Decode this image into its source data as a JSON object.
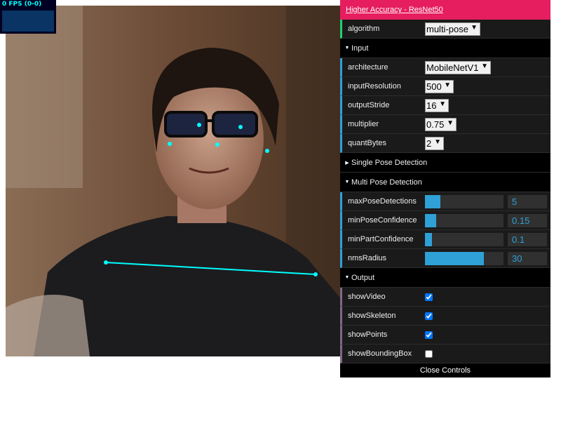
{
  "stats": {
    "fps_text": "0 FPS (0-0)"
  },
  "gui": {
    "title": "Higher Accuracy - ResNet50",
    "algorithm": {
      "label": "algorithm",
      "value": "multi-pose"
    },
    "input_folder": {
      "label": "Input"
    },
    "architecture": {
      "label": "architecture",
      "value": "MobileNetV1"
    },
    "inputResolution": {
      "label": "inputResolution",
      "value": "500"
    },
    "outputStride": {
      "label": "outputStride",
      "value": "16"
    },
    "multiplier": {
      "label": "multiplier",
      "value": "0.75"
    },
    "quantBytes": {
      "label": "quantBytes",
      "value": "2"
    },
    "single_folder": {
      "label": "Single Pose Detection"
    },
    "multi_folder": {
      "label": "Multi Pose Detection"
    },
    "maxPoseDetections": {
      "label": "maxPoseDetections",
      "value": "5",
      "fraction": 0.2
    },
    "minPoseConfidence": {
      "label": "minPoseConfidence",
      "value": "0.15",
      "fraction": 0.14
    },
    "minPartConfidence": {
      "label": "minPartConfidence",
      "value": "0.1",
      "fraction": 0.09
    },
    "nmsRadius": {
      "label": "nmsRadius",
      "value": "30",
      "fraction": 0.75
    },
    "output_folder": {
      "label": "Output"
    },
    "showVideo": {
      "label": "showVideo",
      "checked": true
    },
    "showSkeleton": {
      "label": "showSkeleton",
      "checked": true
    },
    "showPoints": {
      "label": "showPoints",
      "checked": true
    },
    "showBoundingBox": {
      "label": "showBoundingBox",
      "checked": false
    },
    "close_label": "Close Controls"
  },
  "colors": {
    "accent": "#e61d5f",
    "keypoint": "#00ffff",
    "slider": "#2fa1d6"
  }
}
